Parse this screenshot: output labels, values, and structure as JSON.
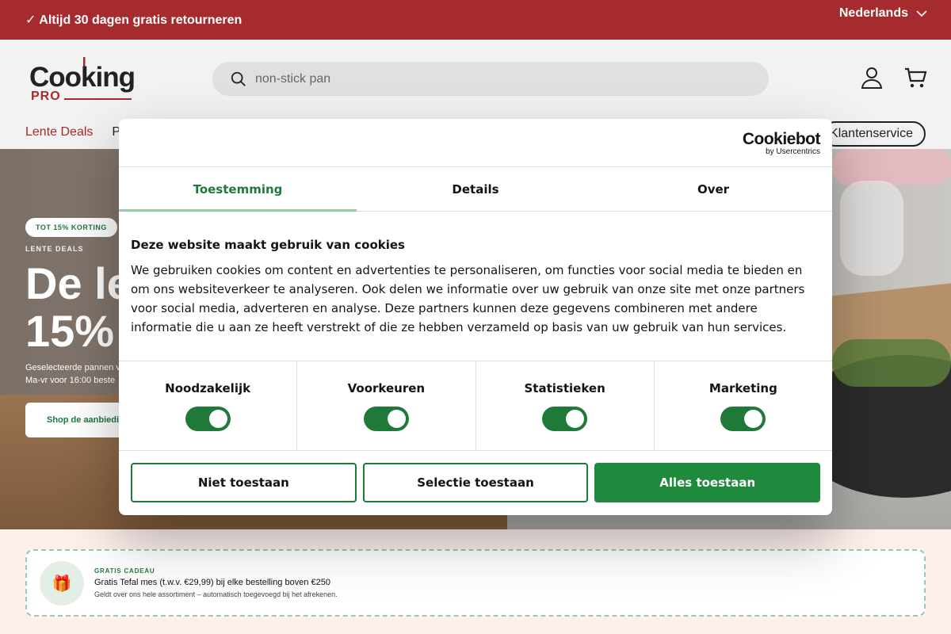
{
  "topbar": {
    "promo": "✓ Altijd 30 dagen gratis retourneren",
    "language": "Nederlands"
  },
  "header": {
    "logo_word": "Cooking",
    "logo_sub": "PRO",
    "search_placeholder": "non-stick pan",
    "nav": [
      {
        "label": "Lente Deals"
      },
      {
        "label": "P"
      }
    ],
    "service_label": "Klantenservice",
    "icons": [
      "search-icon",
      "account-icon",
      "cart-icon"
    ]
  },
  "hero": {
    "badge": "TOT 15% KORTING",
    "eyebrow": "LENTE DEALS",
    "title_line1": "De le",
    "title_line2": "15%",
    "sub_line1": "Geselecteerde pannen v",
    "sub_line2": "Ma-vr voor 16:00 beste",
    "cta": "Shop de aanbieding"
  },
  "gift": {
    "label": "GRATIS CADEAU",
    "main": "Gratis Tefal mes (t.w.v. €29,99) bij elke bestelling boven €250",
    "small": "Geldt over ons hele assortiment – automatisch toegevoegd bij het afrekenen.",
    "icon": "gift-icon"
  },
  "cookie": {
    "brand": "Cookiebot",
    "brand_sub": "by Usercentrics",
    "tabs": [
      {
        "label": "Toestemming",
        "active": true
      },
      {
        "label": "Details",
        "active": false
      },
      {
        "label": "Over",
        "active": false
      }
    ],
    "heading": "Deze website maakt gebruik van cookies",
    "body": "We gebruiken cookies om content en advertenties te personaliseren, om functies voor social media te bieden en om ons websiteverkeer te analyseren. Ook delen we informatie over uw gebruik van onze site met onze partners voor social media, adverteren en analyse. Deze partners kunnen deze gegevens combineren met andere informatie die u aan ze heeft verstrekt of die ze hebben verzameld op basis van uw gebruik van hun services.",
    "categories": [
      {
        "name": "Noodzakelijk",
        "enabled": true
      },
      {
        "name": "Voorkeuren",
        "enabled": true
      },
      {
        "name": "Statistieken",
        "enabled": true
      },
      {
        "name": "Marketing",
        "enabled": true
      }
    ],
    "buttons": {
      "deny": "Niet toestaan",
      "selection": "Selectie toestaan",
      "all": "Alles toestaan"
    }
  },
  "colors": {
    "brand_red": "#a62b2f",
    "consent_green": "#1f7a3a",
    "primary_button": "#1f8a3e"
  }
}
